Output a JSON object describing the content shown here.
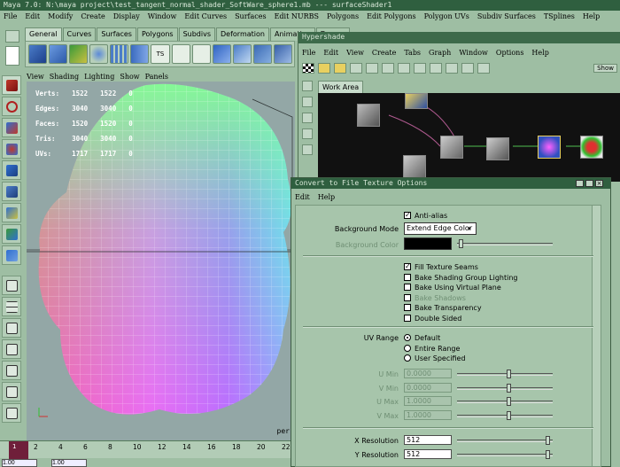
{
  "window": {
    "title": "Maya 7.0: N:\\maya project\\test_tangent_normal_shader_SoftWare_sphere1.mb  ---  surfaceShader1"
  },
  "main_menu": [
    "File",
    "Edit",
    "Modify",
    "Create",
    "Display",
    "Window",
    "Edit Curves",
    "Surfaces",
    "Edit NURBS",
    "Polygons",
    "Edit Polygons",
    "Polygon UVs",
    "Subdiv Surfaces",
    "TSplines",
    "Help"
  ],
  "shelf_tabs": [
    "General",
    "Curves",
    "Surfaces",
    "Polygons",
    "Subdivs",
    "Deformation",
    "Animation",
    "Dynam"
  ],
  "shelf_icon_ts": "TS",
  "viewport": {
    "menu": [
      "View",
      "Shading",
      "Lighting",
      "Show",
      "Panels"
    ],
    "stats": [
      {
        "label": "Verts:",
        "a": "1522",
        "b": "1522",
        "c": "0"
      },
      {
        "label": "Edges:",
        "a": "3040",
        "b": "3040",
        "c": "0"
      },
      {
        "label": "Faces:",
        "a": "1520",
        "b": "1520",
        "c": "0"
      },
      {
        "label": "Tris:",
        "a": "3040",
        "b": "3040",
        "c": "0"
      },
      {
        "label": "UVs:",
        "a": "1717",
        "b": "1717",
        "c": "0"
      }
    ],
    "camera_label": "per"
  },
  "timeline": {
    "ticks": [
      "2",
      "4",
      "6",
      "8",
      "10",
      "12",
      "14",
      "16",
      "18",
      "20",
      "22",
      "24"
    ],
    "current_frame": "1",
    "range_start": "1.00",
    "range_end": "1.00"
  },
  "hypershade": {
    "title": "Hypershade",
    "menu": [
      "File",
      "Edit",
      "View",
      "Create",
      "Tabs",
      "Graph",
      "Window",
      "Options",
      "Help"
    ],
    "show_label": "Show",
    "tab": "Work Area"
  },
  "dialog": {
    "title": "Convert to File Texture Options",
    "menu": [
      "Edit",
      "Help"
    ],
    "anti_alias": "Anti-alias",
    "background_mode_label": "Background Mode",
    "background_mode_value": "Extend Edge Color",
    "background_color_label": "Background Color",
    "checkboxes": [
      {
        "label": "Fill Texture Seams",
        "checked": true,
        "disabled": false
      },
      {
        "label": "Bake Shading Group Lighting",
        "checked": false,
        "disabled": false
      },
      {
        "label": "Bake Using Virtual Plane",
        "checked": false,
        "disabled": false
      },
      {
        "label": "Bake Shadows",
        "checked": false,
        "disabled": true
      },
      {
        "label": "Bake Transparency",
        "checked": false,
        "disabled": false
      },
      {
        "label": "Double Sided",
        "checked": false,
        "disabled": false
      }
    ],
    "uv_range_label": "UV Range",
    "uv_options": [
      "Default",
      "Entire Range",
      "User Specified"
    ],
    "uv_fields": [
      {
        "label": "U Min",
        "value": "0.0000"
      },
      {
        "label": "V Min",
        "value": "0.0000"
      },
      {
        "label": "U Max",
        "value": "1.0000"
      },
      {
        "label": "V Max",
        "value": "1.0000"
      }
    ],
    "x_res_label": "X Resolution",
    "x_res": "512",
    "y_res_label": "Y Resolution",
    "y_res": "512"
  },
  "colors": {
    "ui_bg": "#9ebea3",
    "titlebar": "#2f5f3f"
  }
}
